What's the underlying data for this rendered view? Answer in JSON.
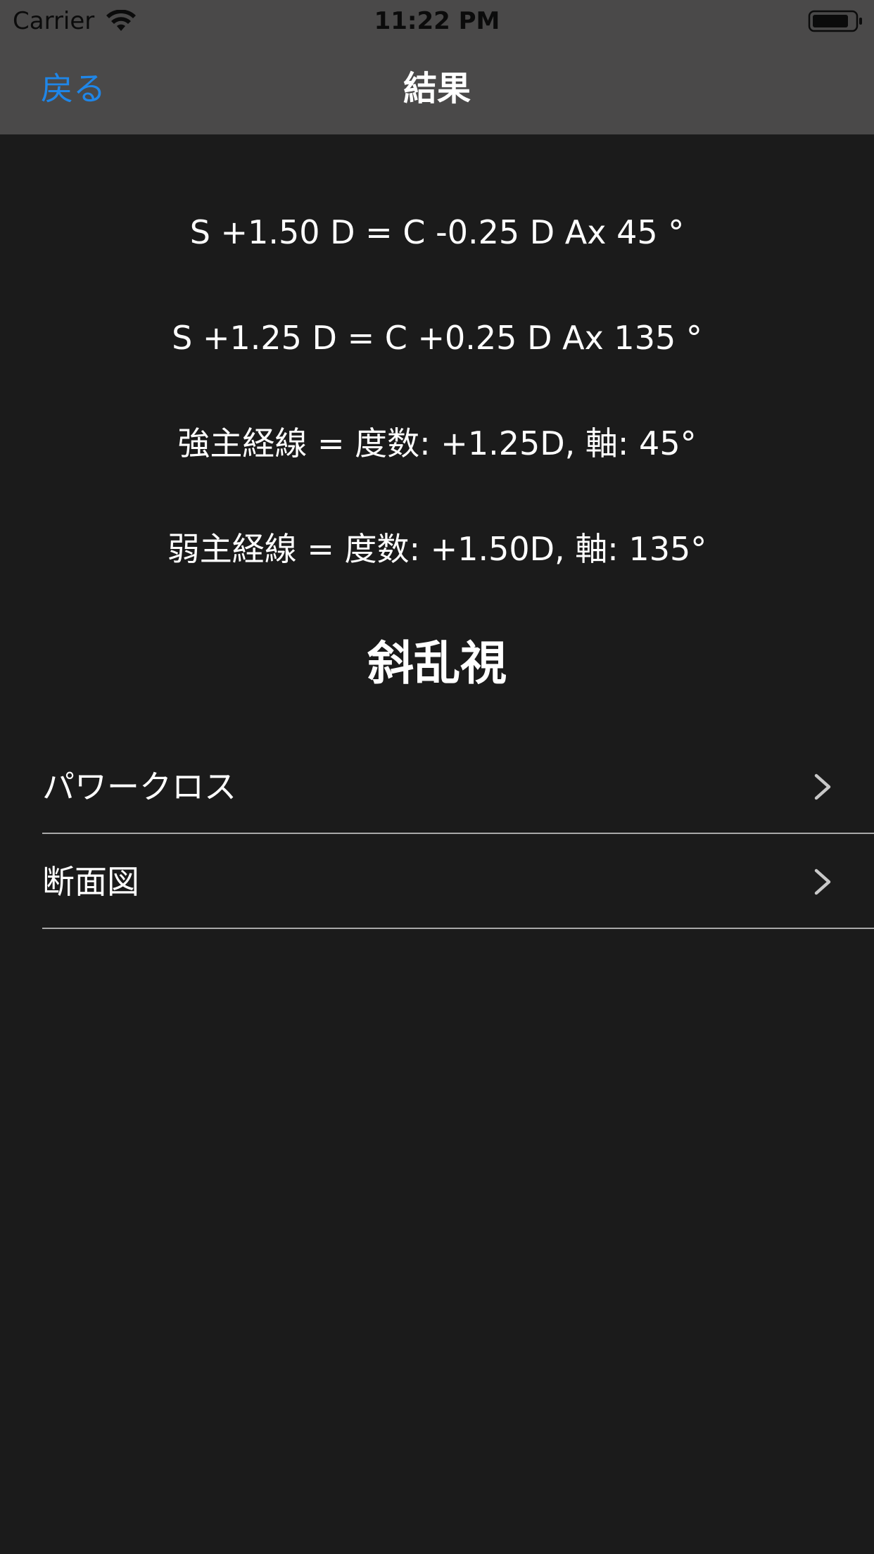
{
  "status_bar": {
    "carrier": "Carrier",
    "time": "11:22 PM"
  },
  "nav": {
    "back_label": "戻る",
    "title": "結果"
  },
  "results": [
    "S +1.50 D = C -0.25 D Ax 45 °",
    "S +1.25 D = C +0.25 D Ax 135 °",
    "強主経線 = 度数: +1.25D, 軸: 45°",
    "弱主経線 = 度数: +1.50D, 軸: 135°"
  ],
  "section_title": "斜乱視",
  "list": [
    {
      "label": "パワークロス",
      "icon": "chevron-right-icon"
    },
    {
      "label": "断面図",
      "icon": "chevron-right-icon"
    }
  ],
  "colors": {
    "header_bg": "#4a4949",
    "page_bg": "#1b1b1b",
    "accent": "#1f86e8"
  }
}
